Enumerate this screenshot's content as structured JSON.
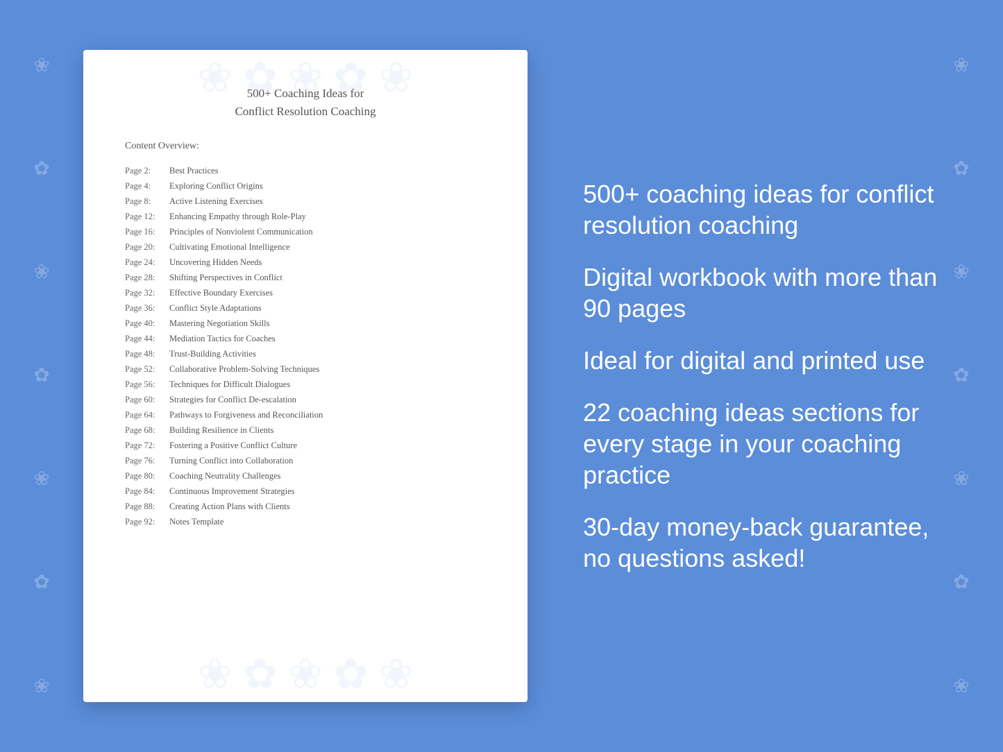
{
  "background": {
    "color": "#5b8dd9"
  },
  "document": {
    "title_line1": "500+ Coaching Ideas for",
    "title_line2": "Conflict Resolution Coaching",
    "content_overview_label": "Content Overview:",
    "toc": [
      {
        "page": "Page  2:",
        "title": "Best Practices"
      },
      {
        "page": "Page  4:",
        "title": "Exploring Conflict Origins"
      },
      {
        "page": "Page  8:",
        "title": "Active Listening Exercises"
      },
      {
        "page": "Page 12:",
        "title": "Enhancing Empathy through Role-Play"
      },
      {
        "page": "Page 16:",
        "title": "Principles of Nonviolent Communication"
      },
      {
        "page": "Page 20:",
        "title": "Cultivating Emotional Intelligence"
      },
      {
        "page": "Page 24:",
        "title": "Uncovering Hidden Needs"
      },
      {
        "page": "Page 28:",
        "title": "Shifting Perspectives in Conflict"
      },
      {
        "page": "Page 32:",
        "title": "Effective Boundary Exercises"
      },
      {
        "page": "Page 36:",
        "title": "Conflict Style Adaptations"
      },
      {
        "page": "Page 40:",
        "title": "Mastering Negotiation Skills"
      },
      {
        "page": "Page 44:",
        "title": "Mediation Tactics for Coaches"
      },
      {
        "page": "Page 48:",
        "title": "Trust-Building Activities"
      },
      {
        "page": "Page 52:",
        "title": "Collaborative Problem-Solving Techniques"
      },
      {
        "page": "Page 56:",
        "title": "Techniques for Difficult Dialogues"
      },
      {
        "page": "Page 60:",
        "title": "Strategies for Conflict De-escalation"
      },
      {
        "page": "Page 64:",
        "title": "Pathways to Forgiveness and Reconciliation"
      },
      {
        "page": "Page 68:",
        "title": "Building Resilience in Clients"
      },
      {
        "page": "Page 72:",
        "title": "Fostering a Positive Conflict Culture"
      },
      {
        "page": "Page 76:",
        "title": "Turning Conflict into Collaboration"
      },
      {
        "page": "Page 80:",
        "title": "Coaching Neutrality Challenges"
      },
      {
        "page": "Page 84:",
        "title": "Continuous Improvement Strategies"
      },
      {
        "page": "Page 88:",
        "title": "Creating Action Plans with Clients"
      },
      {
        "page": "Page 92:",
        "title": "Notes Template"
      }
    ]
  },
  "features": [
    "500+ coaching ideas for conflict resolution coaching",
    "Digital workbook with more than 90 pages",
    "Ideal for digital and printed use",
    "22 coaching ideas sections for every stage in your coaching practice",
    "30-day money-back guarantee, no questions asked!"
  ]
}
